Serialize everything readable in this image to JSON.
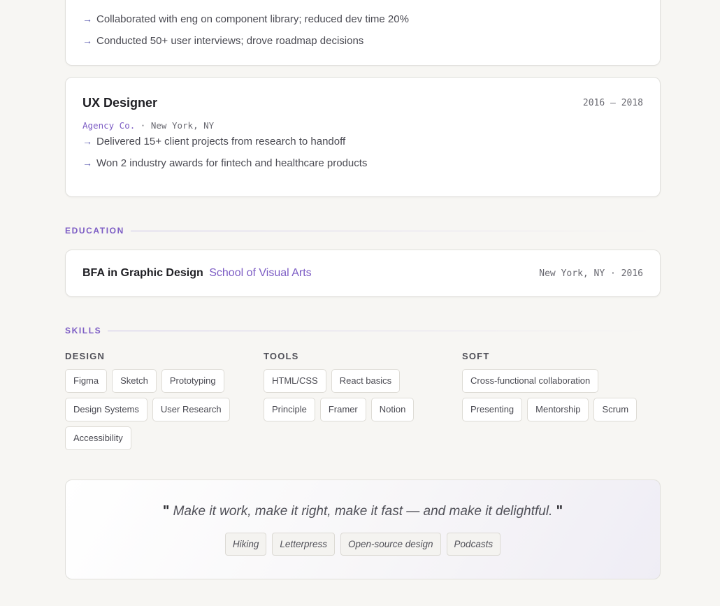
{
  "experience_prev": {
    "bullets": [
      "Collaborated with eng on component library; reduced dev time 20%",
      "Conducted 50+ user interviews; drove roadmap decisions"
    ]
  },
  "experience_ux": {
    "title": "UX Designer",
    "dates": "2016 – 2018",
    "company": "Agency Co.",
    "separator": "·",
    "location": "New York, NY",
    "bullets": [
      "Delivered 15+ client projects from research to handoff",
      "Won 2 industry awards for fintech and healthcare products"
    ]
  },
  "arrow_glyph": "→",
  "education": {
    "heading": "EDUCATION",
    "degree": "BFA in Graphic Design",
    "school": "School of Visual Arts",
    "details": "New York, NY · 2016"
  },
  "skills": {
    "heading": "SKILLS",
    "groups": [
      {
        "title": "DESIGN",
        "items": [
          "Figma",
          "Sketch",
          "Prototyping",
          "Design Systems",
          "User Research",
          "Accessibility"
        ]
      },
      {
        "title": "TOOLS",
        "items": [
          "HTML/CSS",
          "React basics",
          "Principle",
          "Framer",
          "Notion"
        ]
      },
      {
        "title": "SOFT",
        "items": [
          "Cross-functional collaboration",
          "Presenting",
          "Mentorship",
          "Scrum"
        ]
      }
    ]
  },
  "quote": {
    "open_mark": "\"",
    "text": "Make it work, make it right, make it fast — and make it delightful.",
    "close_mark": "\""
  },
  "interests": [
    "Hiking",
    "Letterpress",
    "Open-source design",
    "Podcasts"
  ],
  "colors": {
    "accent": "#7c5cc4",
    "background": "#f7f6f3",
    "card": "#ffffff"
  }
}
